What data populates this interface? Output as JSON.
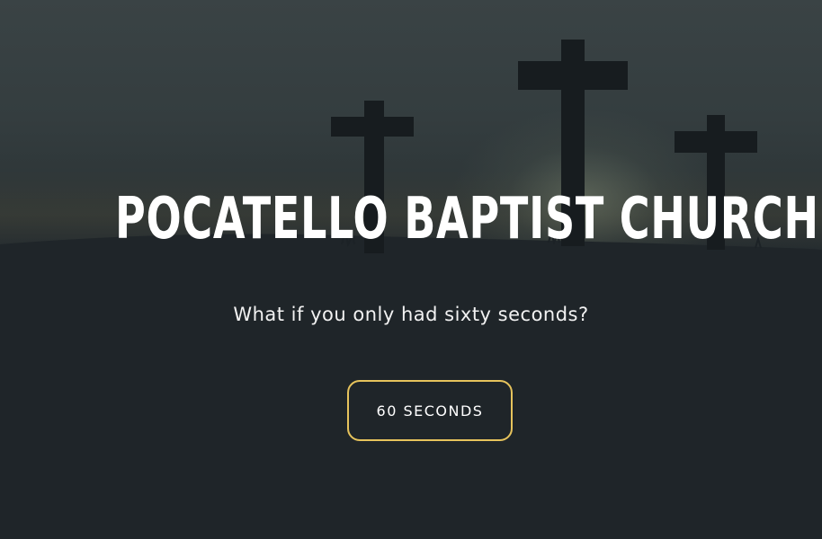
{
  "hero": {
    "title": "POCATELLO BAPTIST CHURCH",
    "subtitle": "What if you only had sixty seconds?",
    "cta_label": "60 SECONDS",
    "background_image": "three-crosses-silhouette",
    "accent_color": "#e6c35c"
  }
}
